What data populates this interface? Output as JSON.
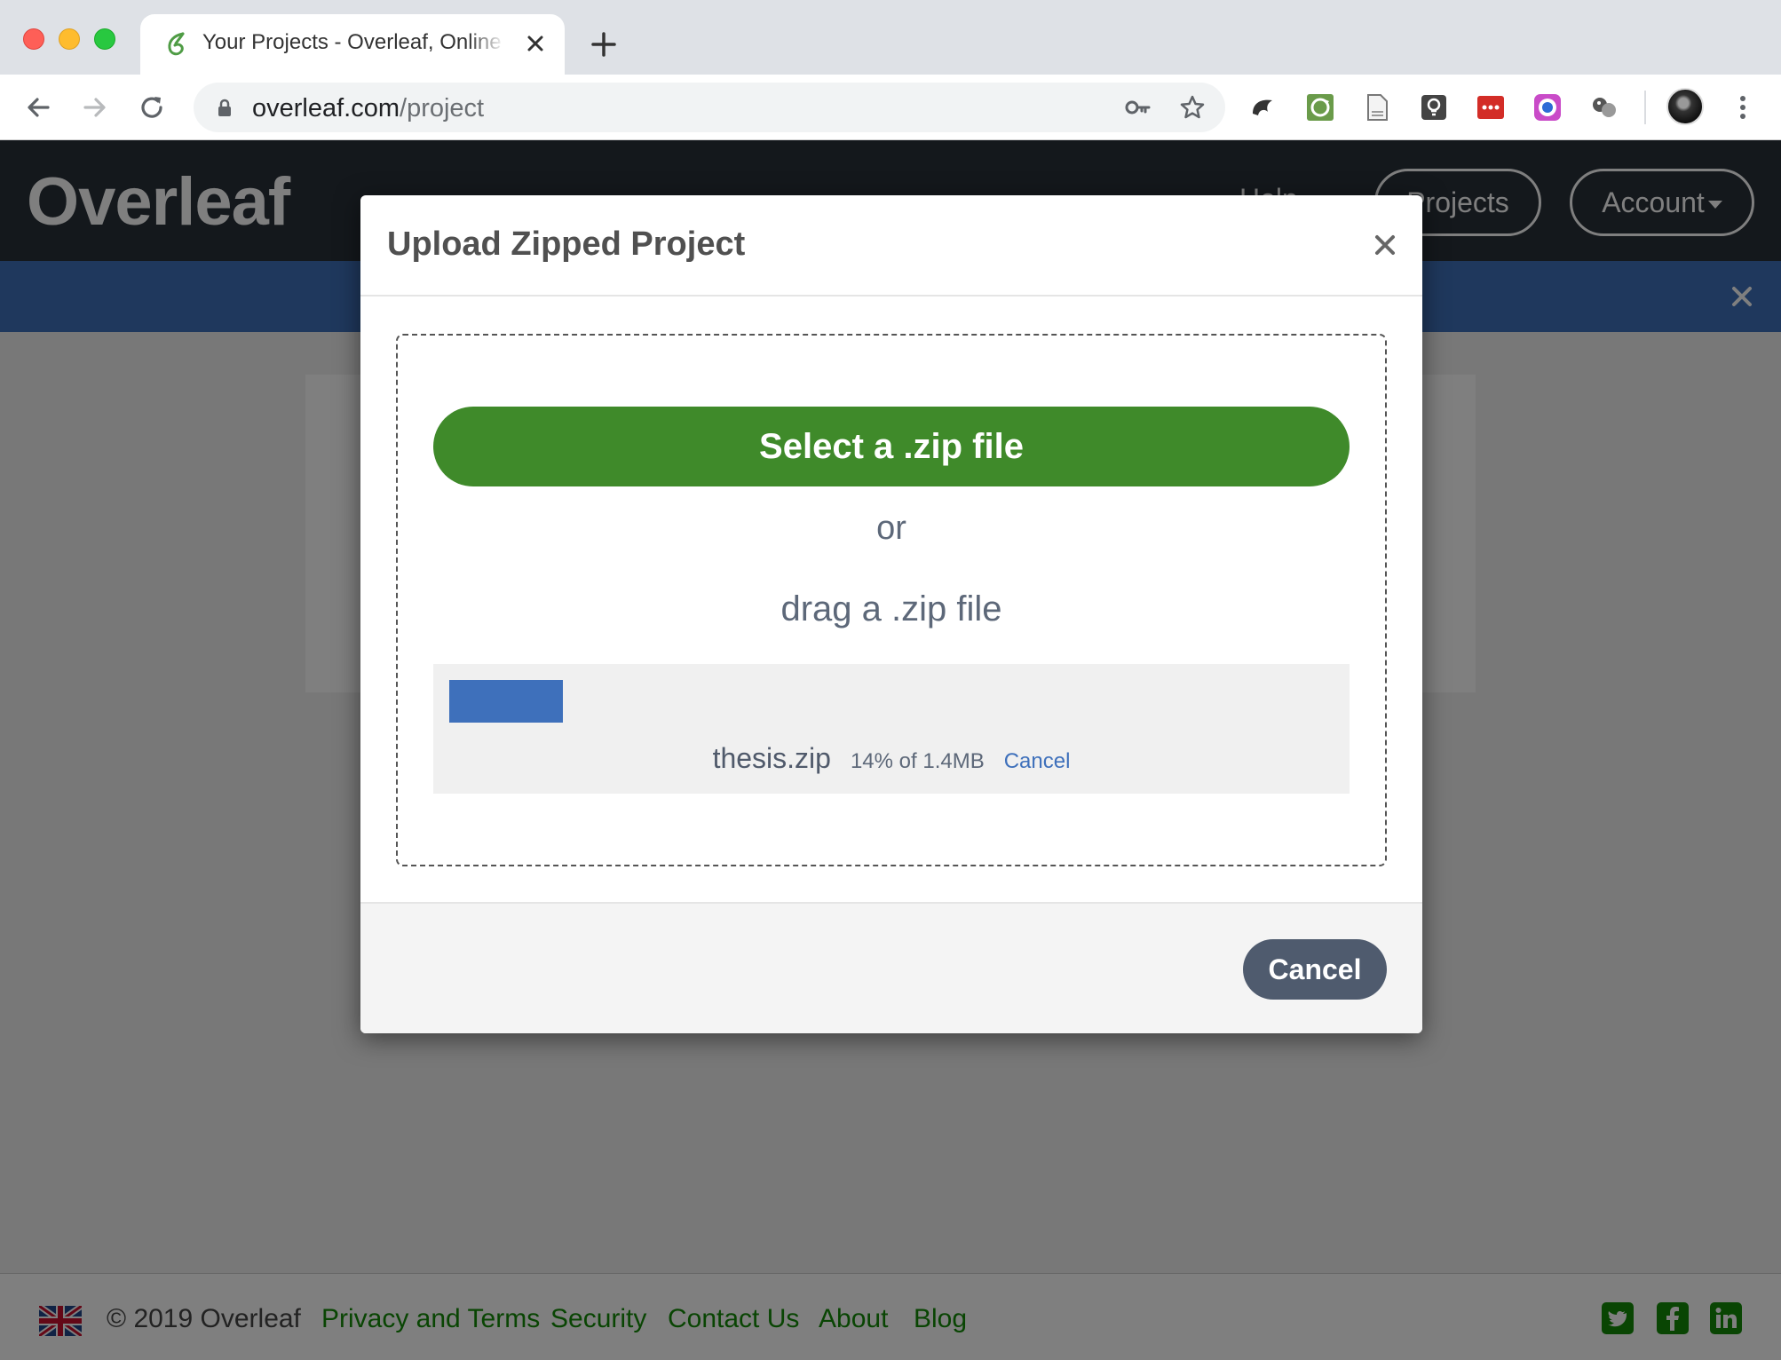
{
  "browser": {
    "tab_title": "Your Projects - Overleaf, Online LaTeX Editor",
    "url_host": "overleaf.com",
    "url_path": "/project",
    "extensions": [
      "overleaf-extension-icon",
      "sync-extension-icon",
      "document-extension-icon",
      "idea-extension-icon",
      "lastpass-extension-icon",
      "color-picker-extension-icon",
      "spheres-extension-icon"
    ]
  },
  "header": {
    "logo": "Overleaf",
    "nav_help": "Help",
    "nav_projects": "Projects",
    "nav_account": "Account"
  },
  "modal": {
    "title": "Upload Zipped Project",
    "select_button": "Select a .zip file",
    "or_text": "or",
    "drag_text": "drag a .zip file",
    "upload": {
      "file_name": "thesis.zip",
      "progress_text": "14% of 1.4MB",
      "progress_fraction": 0.14,
      "cancel_link": "Cancel"
    },
    "cancel_button": "Cancel"
  },
  "footer": {
    "copyright": "© 2019 Overleaf",
    "links": [
      "Privacy and Terms",
      "Security",
      "Contact Us",
      "About",
      "Blog"
    ],
    "social": [
      "twitter-icon",
      "facebook-icon",
      "linkedin-icon"
    ]
  },
  "colors": {
    "header_bg": "#293039",
    "notification_bar": "#3e70bb",
    "select_button": "#3f8a2a",
    "cancel_button": "#4f5b6e",
    "progress": "#3e70bb",
    "footer_link": "#138a07"
  }
}
